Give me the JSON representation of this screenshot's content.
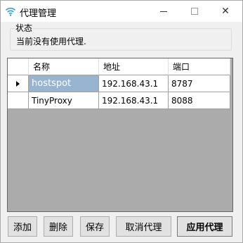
{
  "window": {
    "title": "代理管理",
    "controls": {
      "minimize_icon": "minimize-icon",
      "maximize_icon": "maximize-icon",
      "close_icon": "close-icon",
      "close_glyph": "✕"
    }
  },
  "status": {
    "legend": "状态",
    "text": "当前没有使用代理."
  },
  "grid": {
    "columns": [
      "名称",
      "地址",
      "端口"
    ],
    "rows": [
      {
        "name": "hostspot",
        "address": "192.168.43.1",
        "port": "8787",
        "selected": true,
        "current": true
      },
      {
        "name": "TinyProxy",
        "address": "192.168.43.1",
        "port": "8088",
        "selected": false,
        "current": false
      }
    ]
  },
  "buttons": {
    "add": "添加",
    "delete": "删除",
    "save": "保存",
    "cancel_proxy": "取消代理",
    "apply_proxy": "应用代理"
  },
  "colors": {
    "selection": "#99b4d1",
    "grid_background": "#ababab",
    "window_background": "#f0f0f0"
  }
}
